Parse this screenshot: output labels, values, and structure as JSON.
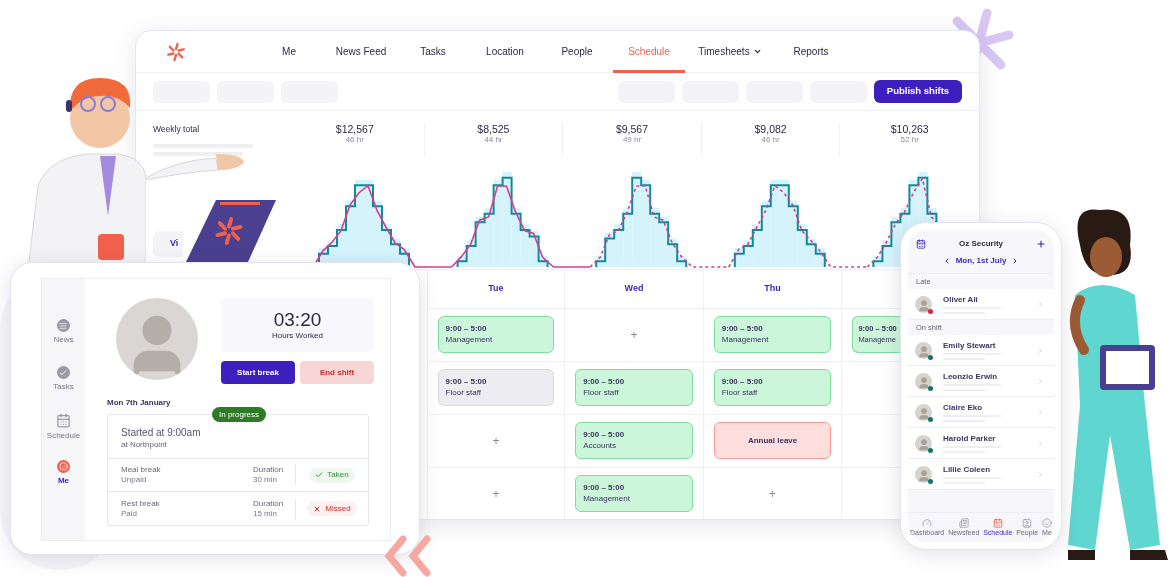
{
  "desktop": {
    "nav": [
      {
        "label": "Me",
        "selected": false,
        "dropdown": false
      },
      {
        "label": "News Feed",
        "selected": false,
        "dropdown": false
      },
      {
        "label": "Tasks",
        "selected": false,
        "dropdown": false
      },
      {
        "label": "Location",
        "selected": false,
        "dropdown": false
      },
      {
        "label": "People",
        "selected": false,
        "dropdown": false
      },
      {
        "label": "Schedule",
        "selected": true,
        "dropdown": false
      },
      {
        "label": "Timesheets",
        "selected": false,
        "dropdown": true
      },
      {
        "label": "Reports",
        "selected": false,
        "dropdown": false
      }
    ],
    "toolbar": {
      "primary_button": "Publish shifts"
    },
    "summary": {
      "title": "Weekly total",
      "button": "Vi",
      "days": [
        {
          "total": "$12,567",
          "hours": "46 hr"
        },
        {
          "total": "$8,525",
          "hours": "44 hr"
        },
        {
          "total": "$9,567",
          "hours": "49 hr"
        },
        {
          "total": "$9,082",
          "hours": "46 hr"
        },
        {
          "total": "$10,263",
          "hours": "52 hr"
        }
      ]
    },
    "schedule": {
      "day_headers": [
        "Tue",
        "Wed",
        "Thu"
      ],
      "rows": [
        {
          "cells": [
            {
              "kind": "shift",
              "time": "9:00 – 5:00",
              "role": "Management",
              "color": "#ccf6d9"
            },
            {
              "kind": "add",
              "label": "+"
            },
            {
              "kind": "shift",
              "time": "9:00 – 5:00",
              "role": "Management",
              "color": "#ccf6d9"
            },
            {
              "kind": "shift",
              "time": "9:00 – 5:00",
              "role": "Manageme",
              "color": "#ccf6d9"
            }
          ]
        },
        {
          "cells": [
            {
              "kind": "shift",
              "time": "9:00 – 5:00",
              "role": "Floor staff",
              "color": "#ececf1"
            },
            {
              "kind": "shift",
              "time": "9:00 – 5:00",
              "role": "Floor staff",
              "color": "#ccf6d9"
            },
            {
              "kind": "shift",
              "time": "9:00 – 5:00",
              "role": "Floor staff",
              "color": "#ccf6d9"
            },
            {
              "kind": "empty"
            }
          ]
        },
        {
          "cells": [
            {
              "kind": "add",
              "label": "+"
            },
            {
              "kind": "shift",
              "time": "9:00 – 5:00",
              "role": "Accounts",
              "color": "#ccf6d9"
            },
            {
              "kind": "leave",
              "label": "Annual leave"
            },
            {
              "kind": "empty"
            }
          ]
        },
        {
          "cells": [
            {
              "kind": "add",
              "label": "+"
            },
            {
              "kind": "shift",
              "time": "9:00 – 5:00",
              "role": "Management",
              "color": "#ccf6d9"
            },
            {
              "kind": "add",
              "label": "+"
            },
            {
              "kind": "empty"
            }
          ]
        }
      ]
    }
  },
  "tablet": {
    "sidebar": [
      {
        "label": "News",
        "kind": "news",
        "selected": false
      },
      {
        "label": "Tasks",
        "kind": "tasks",
        "selected": false
      },
      {
        "label": "Schedule",
        "kind": "schedule",
        "selected": false
      },
      {
        "label": "Me",
        "kind": "me",
        "selected": true
      }
    ],
    "timer": {
      "time": "03:20",
      "caption": "Hours Worked"
    },
    "buttons": [
      {
        "label": "Start break",
        "kind": "primary"
      },
      {
        "label": "End shift",
        "kind": "danger"
      }
    ],
    "date": "Mon 7th January",
    "shift": {
      "badge": "In progress",
      "title": "Started at 9:00am",
      "location": "at Northpoint",
      "breaks": [
        {
          "name": "Meal break",
          "pay": "Unpaid",
          "duration_label": "Duration",
          "duration": "30 min",
          "status": "Taken",
          "kind": "taken"
        },
        {
          "name": "Rest break",
          "pay": "Paid",
          "duration_label": "Duration",
          "duration": "15 min",
          "status": "Missed",
          "kind": "missed"
        }
      ]
    }
  },
  "phone": {
    "title": "Oz Security",
    "date": "Mon, 1st July",
    "sections": [
      {
        "title": "Late",
        "people": [
          {
            "name": "Oliver Ali",
            "color": "#e11d48"
          }
        ]
      },
      {
        "title": "On shift",
        "people": [
          {
            "name": "Emily Stewart",
            "color": "#0f766e"
          },
          {
            "name": "Leonzio Erwin",
            "color": "#0f766e"
          },
          {
            "name": "Claire Eko",
            "color": "#0f766e"
          },
          {
            "name": "Harold Parker",
            "color": "#0f766e"
          },
          {
            "name": "Lillie Coleen",
            "color": "#0f766e"
          }
        ]
      }
    ],
    "tabs": [
      {
        "label": "Dashboard",
        "kind": "dashboard",
        "selected": false
      },
      {
        "label": "Newsfeed",
        "kind": "newsfeed",
        "selected": false
      },
      {
        "label": "Schedule",
        "kind": "schedule",
        "selected": true
      },
      {
        "label": "People",
        "kind": "people",
        "selected": false
      },
      {
        "label": "Me",
        "kind": "me",
        "selected": false
      }
    ]
  }
}
